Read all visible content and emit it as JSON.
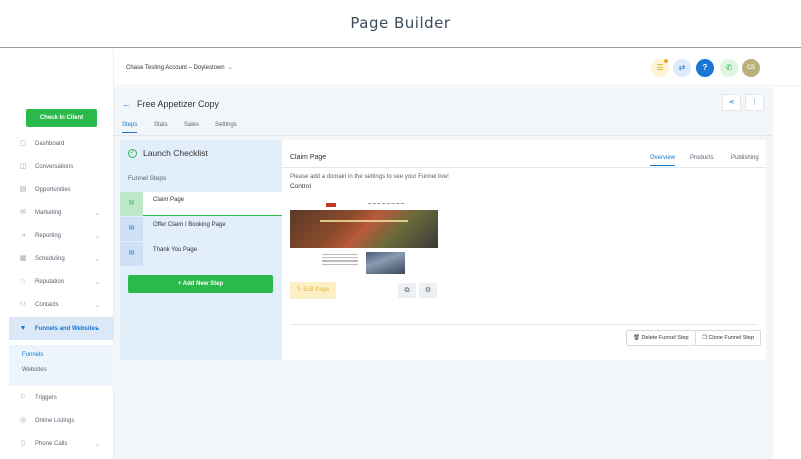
{
  "page": {
    "title": "Page Builder"
  },
  "sidebar": {
    "check_in_label": "Check In Client",
    "items": [
      {
        "label": "Dashboard",
        "icon": "dashboard-icon",
        "glyph": "▢",
        "chev": ""
      },
      {
        "label": "Conversations",
        "icon": "chat-icon",
        "glyph": "◫",
        "chev": ""
      },
      {
        "label": "Opportunities",
        "icon": "funnel-stack-icon",
        "glyph": "▤",
        "chev": ""
      },
      {
        "label": "Marketing",
        "icon": "mail-icon",
        "glyph": "✉",
        "chev": "⌄"
      },
      {
        "label": "Reporting",
        "icon": "chart-icon",
        "glyph": "⩘",
        "chev": "⌄"
      },
      {
        "label": "Scheduling",
        "icon": "calendar-icon",
        "glyph": "▦",
        "chev": "⌄"
      },
      {
        "label": "Reputation",
        "icon": "star-icon",
        "glyph": "☆",
        "chev": "⌄"
      },
      {
        "label": "Contacts",
        "icon": "person-icon",
        "glyph": "⚇",
        "chev": "⌄"
      },
      {
        "label": "Funnels and Websites",
        "icon": "filter-icon",
        "glyph": "▼",
        "chev": "⌄"
      },
      {
        "label": "Triggers",
        "icon": "trigger-icon",
        "glyph": "⚐",
        "chev": ""
      },
      {
        "label": "Online Listings",
        "icon": "listings-icon",
        "glyph": "◎",
        "chev": ""
      },
      {
        "label": "Phone Calls",
        "icon": "phone-icon",
        "glyph": "▯",
        "chev": "⌄"
      }
    ],
    "subnav": [
      "Funnels",
      "Websites"
    ]
  },
  "topbar": {
    "account": "Chase Testing Account – Doylestown",
    "account_chev": "⌄",
    "list_glyph": "☰",
    "swap_glyph": "⇄",
    "help_glyph": "?",
    "phone_glyph": "✆",
    "avatar_initials": "CB"
  },
  "funnel": {
    "back_glyph": "←",
    "title": "Free Appetizer Copy",
    "share_glyph": "⋖",
    "more_glyph": "⋮",
    "tabs": [
      "Steps",
      "Stats",
      "Sales",
      "Settings"
    ]
  },
  "checklist": {
    "title": "Launch Checklist",
    "check_glyph": "✓",
    "steps_heading": "Funnel Steps",
    "step_glyph": "✉",
    "steps": [
      "Claim Page",
      "Offer Claim / Booking Page",
      "Thank You Page"
    ],
    "add_label": "+ Add New Step"
  },
  "detail": {
    "title": "Claim Page",
    "tabs": [
      "Overview",
      "Products",
      "Publishing"
    ],
    "notice": "Please add a domain in the settings to see your Funnel live!",
    "variant": "Control",
    "edit_label": "✎ Edit Page",
    "open_glyph": "⧉",
    "settings_glyph": "⚙",
    "delete_label": "🗑 Delete Funnel Step",
    "clone_label": "❐ Clone Funnel Step"
  }
}
